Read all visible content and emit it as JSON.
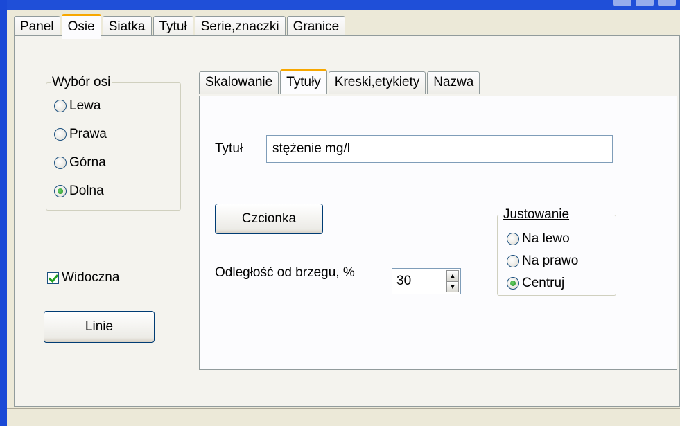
{
  "top_tabs": [
    "Panel",
    "Osie",
    "Siatka",
    "Tytuł",
    "Serie,znaczki",
    "Granice"
  ],
  "active_top_tab": "Osie",
  "axis_group": {
    "legend": "Wybór osi",
    "options": [
      "Lewa",
      "Prawa",
      "Górna",
      "Dolna"
    ],
    "selected": "Dolna"
  },
  "visible_checkbox": {
    "label": "Widoczna",
    "checked": true
  },
  "lines_button": "Linie",
  "inner_tabs": [
    "Skalowanie",
    "Tytuły",
    "Kreski,etykiety",
    "Nazwa"
  ],
  "active_inner_tab": "Tytuły",
  "title_field": {
    "label": "Tytuł",
    "value": "stężenie mg/l"
  },
  "font_button": "Czcionka",
  "distance": {
    "label": "Odległość od  brzegu, %",
    "value": "30"
  },
  "justify_group": {
    "legend": "Justowanie",
    "options": [
      "Na lewo",
      "Na prawo",
      "Centruj"
    ],
    "selected": "Centruj"
  }
}
